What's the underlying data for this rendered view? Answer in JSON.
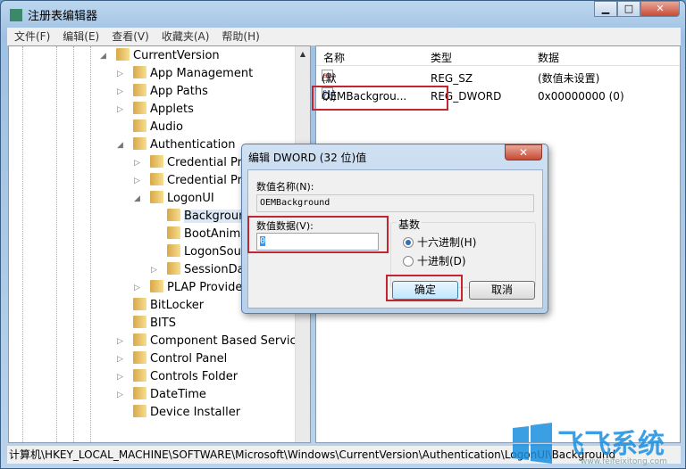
{
  "window": {
    "title": "注册表编辑器",
    "minimize": "▁",
    "maximize": "□",
    "close": "✕"
  },
  "menu": [
    "文件(F)",
    "编辑(E)",
    "查看(V)",
    "收藏夹(A)",
    "帮助(H)"
  ],
  "tree": [
    {
      "label": "CurrentVersion",
      "level": 0,
      "arrow": "◢"
    },
    {
      "label": "App Management",
      "level": 1,
      "arrow": "▷"
    },
    {
      "label": "App Paths",
      "level": 1,
      "arrow": "▷"
    },
    {
      "label": "Applets",
      "level": 1,
      "arrow": "▷"
    },
    {
      "label": "Audio",
      "level": 1,
      "arrow": ""
    },
    {
      "label": "Authentication",
      "level": 1,
      "arrow": "◢"
    },
    {
      "label": "Credential Pro",
      "level": 2,
      "arrow": "▷"
    },
    {
      "label": "Credential Pro",
      "level": 2,
      "arrow": "▷"
    },
    {
      "label": "LogonUI",
      "level": 2,
      "arrow": "◢"
    },
    {
      "label": "Background",
      "level": 3,
      "arrow": "",
      "selected": true
    },
    {
      "label": "BootAnimation",
      "level": 3,
      "arrow": ""
    },
    {
      "label": "LogonSoun",
      "level": 3,
      "arrow": ""
    },
    {
      "label": "SessionData",
      "level": 3,
      "arrow": "▷"
    },
    {
      "label": "PLAP Providers",
      "level": 2,
      "arrow": "▷"
    },
    {
      "label": "BitLocker",
      "level": 1,
      "arrow": ""
    },
    {
      "label": "BITS",
      "level": 1,
      "arrow": ""
    },
    {
      "label": "Component Based Servicing",
      "level": 1,
      "arrow": "▷"
    },
    {
      "label": "Control Panel",
      "level": 1,
      "arrow": "▷"
    },
    {
      "label": "Controls Folder",
      "level": 1,
      "arrow": "▷"
    },
    {
      "label": "DateTime",
      "level": 1,
      "arrow": "▷"
    },
    {
      "label": "Device Installer",
      "level": 1,
      "arrow": ""
    }
  ],
  "list": {
    "columns": [
      "名称",
      "类型",
      "数据"
    ],
    "rows": [
      {
        "icon": "ab",
        "name": "(默认)",
        "type": "REG_SZ",
        "data": "(数值未设置)"
      },
      {
        "icon": "011",
        "name": "OEMBackgrou...",
        "type": "REG_DWORD",
        "data": "0x00000000 (0)"
      }
    ]
  },
  "status": "计算机\\HKEY_LOCAL_MACHINE\\SOFTWARE\\Microsoft\\Windows\\CurrentVersion\\Authentication\\LogonUI\\Background",
  "dialog": {
    "title": "编辑 DWORD (32 位)值",
    "close": "✕",
    "name_label": "数值名称(N):",
    "name_value": "OEMBackground",
    "data_label": "数值数据(V):",
    "data_value": "0",
    "base_label": "基数",
    "hex_label": "十六进制(H)",
    "dec_label": "十进制(D)",
    "base_selected": "hex",
    "ok": "确定",
    "cancel": "取消"
  },
  "watermark": {
    "text": "飞飞系统",
    "url": "www.feifeixitong.com"
  },
  "colors": {
    "highlight_box": "#c3262e",
    "watermark": "#1a8fe0"
  }
}
